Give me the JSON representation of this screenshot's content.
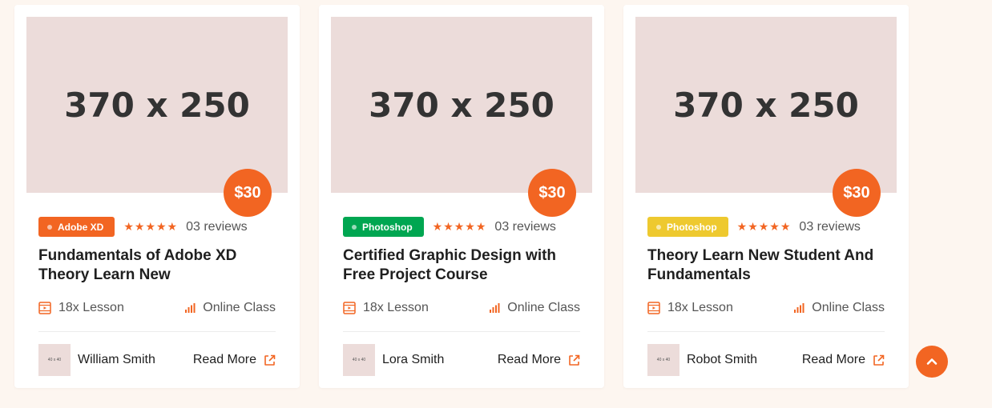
{
  "colors": {
    "accent": "#f26522",
    "star": "#f26522"
  },
  "cards": [
    {
      "image_placeholder": "370 x 250",
      "price": "$30",
      "tag": {
        "label": "Adobe XD",
        "color": "#f26522"
      },
      "rating": 5,
      "reviews": "03 reviews",
      "title": "Fundamentals of Adobe XD Theory Learn New",
      "lessons": "18x Lesson",
      "level": "Online Class",
      "author": {
        "avatar_placeholder": "40 x 40",
        "name": "William Smith"
      },
      "read_more": "Read More"
    },
    {
      "image_placeholder": "370 x 250",
      "price": "$30",
      "tag": {
        "label": "Photoshop",
        "color": "#00a651"
      },
      "rating": 5,
      "reviews": "03 reviews",
      "title": "Certified Graphic Design with Free Project Course",
      "lessons": "18x Lesson",
      "level": "Online Class",
      "author": {
        "avatar_placeholder": "40 x 40",
        "name": "Lora Smith"
      },
      "read_more": "Read More"
    },
    {
      "image_placeholder": "370 x 250",
      "price": "$30",
      "tag": {
        "label": "Photoshop",
        "color": "#eec92f"
      },
      "rating": 5,
      "reviews": "03 reviews",
      "title": "Theory Learn New Student And Fundamentals",
      "lessons": "18x Lesson",
      "level": "Online Class",
      "author": {
        "avatar_placeholder": "40 x 40",
        "name": "Robot Smith"
      },
      "read_more": "Read More"
    }
  ],
  "icons": {
    "lesson": "video-lesson-icon",
    "level": "signal-bars-icon",
    "external": "external-link-icon",
    "scroll_top": "chevron-up-icon"
  }
}
